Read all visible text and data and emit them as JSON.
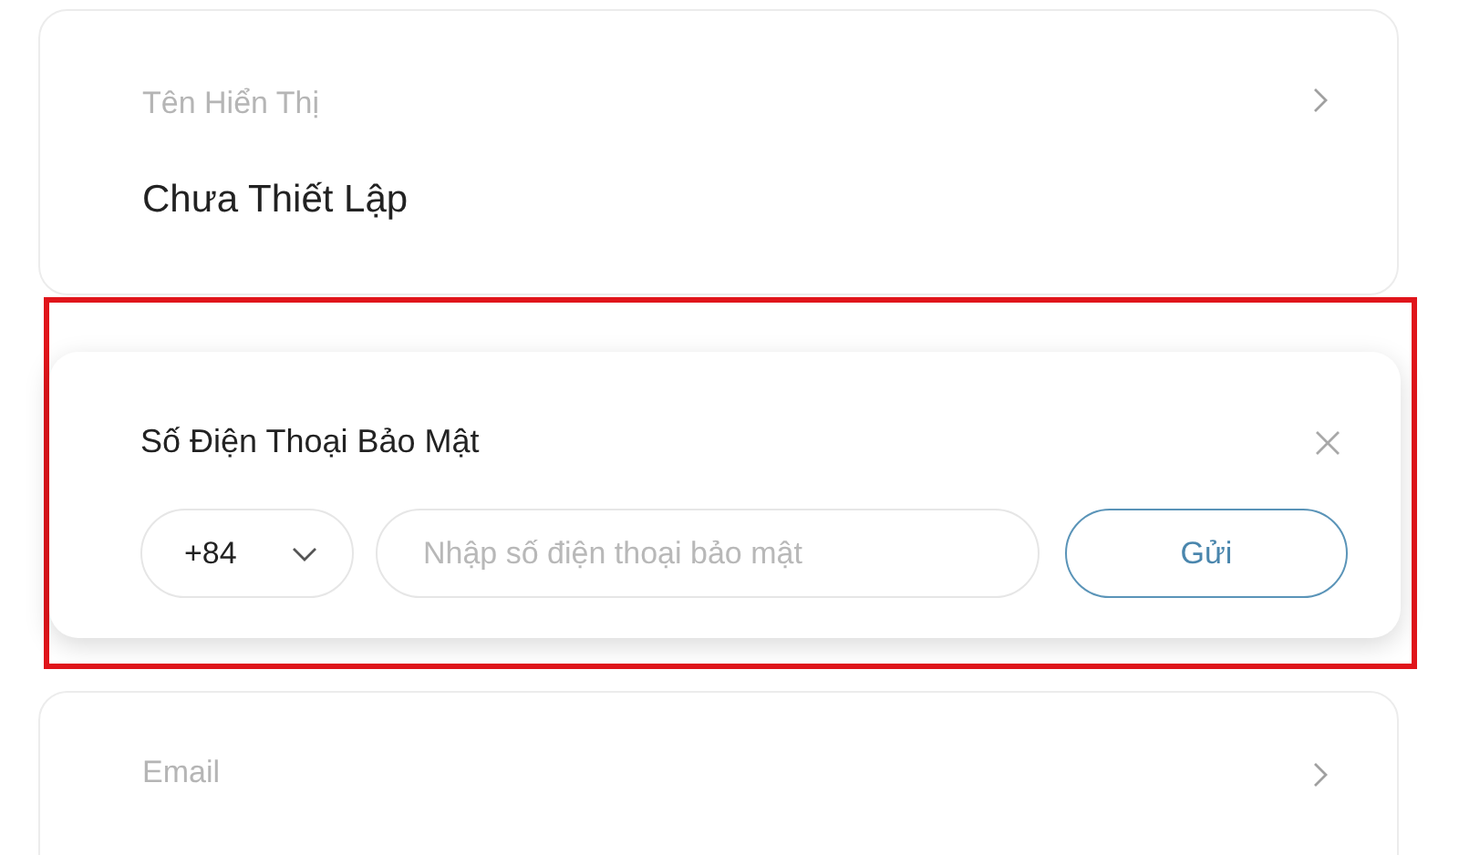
{
  "display_name": {
    "label": "Tên Hiển Thị",
    "value": "Chưa Thiết Lập"
  },
  "secure_phone": {
    "title": "Số Điện Thoại Bảo Mật",
    "country_code": "+84",
    "phone_field": {
      "placeholder": "Nhập số điện thoại bảo mật"
    },
    "send_button": "Gửi"
  },
  "email": {
    "label": "Email"
  }
}
